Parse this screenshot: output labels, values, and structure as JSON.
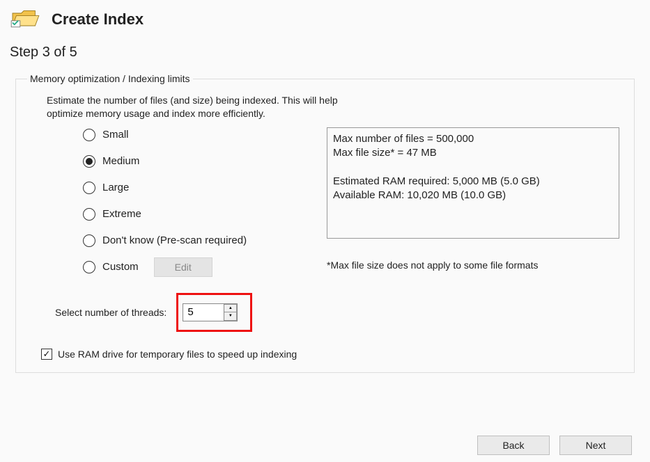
{
  "header": {
    "title": "Create Index",
    "step_label": "Step 3 of 5"
  },
  "group": {
    "legend": "Memory optimization / Indexing limits",
    "description_line1": "Estimate the number of files (and size) being indexed. This will help",
    "description_line2": "optimize memory usage and index more efficiently."
  },
  "size_options": {
    "small": "Small",
    "medium": "Medium",
    "large": "Large",
    "extreme": "Extreme",
    "dont_know": "Don't know (Pre-scan required)",
    "custom": "Custom",
    "edit_button": "Edit",
    "selected": "medium"
  },
  "info": {
    "max_files": "Max number of files = 500,000",
    "max_size": "Max file size* = 47 MB",
    "est_ram": "Estimated RAM required: 5,000 MB (5.0 GB)",
    "avail_ram": "Available RAM: 10,020 MB (10.0 GB)",
    "footnote": "*Max file size does not apply to some file formats"
  },
  "threads": {
    "label": "Select number of threads:",
    "value": "5"
  },
  "ram_drive": {
    "label": "Use RAM drive for temporary files to speed up indexing",
    "checked": true
  },
  "nav": {
    "back": "Back",
    "next": "Next"
  }
}
